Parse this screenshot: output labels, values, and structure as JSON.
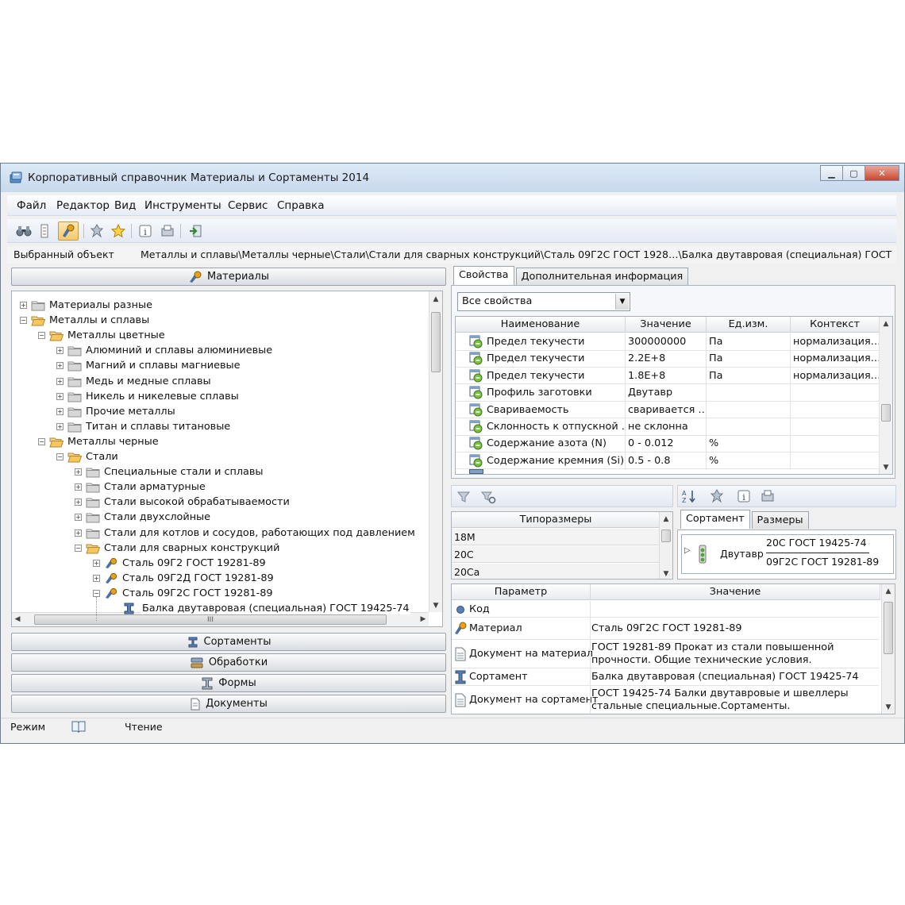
{
  "window": {
    "title": "Корпоративный справочник Материалы и Сортаменты 2014",
    "controls": {
      "minimize": "▁",
      "maximize": "▢",
      "close": "✕"
    }
  },
  "menu": [
    {
      "label": "Файл"
    },
    {
      "label": "Редактор"
    },
    {
      "label": "Вид"
    },
    {
      "label": "Инструменты"
    },
    {
      "label": "Сервис"
    },
    {
      "label": "Справка"
    }
  ],
  "toolbar": {
    "icons": [
      "binoculars-icon",
      "tree-icon",
      "materials-icon",
      "pin-icon",
      "star-icon",
      "info-icon",
      "report-icon",
      "exit-icon"
    ]
  },
  "selected_object": {
    "label": "Выбранный объект",
    "path": "Металлы и сплавы\\Металлы черные\\Стали\\Стали для сварных конструкций\\Сталь 09Г2С ГОСТ 1928…\\Балка двутавровая (специальная) ГОСТ 19425-74"
  },
  "left_panel": {
    "header": "Материалы",
    "tree": [
      {
        "label": "Материалы разные",
        "level": 0,
        "expanded": false,
        "icon": "folder"
      },
      {
        "label": "Металлы и сплавы",
        "level": 0,
        "expanded": true,
        "icon": "folder-open"
      },
      {
        "label": "Металлы цветные",
        "level": 1,
        "expanded": true,
        "icon": "folder-open"
      },
      {
        "label": "Алюминий и сплавы алюминиевые",
        "level": 2,
        "expanded": false,
        "icon": "folder"
      },
      {
        "label": "Магний и сплавы магниевые",
        "level": 2,
        "expanded": false,
        "icon": "folder"
      },
      {
        "label": "Медь и медные сплавы",
        "level": 2,
        "expanded": false,
        "icon": "folder"
      },
      {
        "label": "Никель и никелевые сплавы",
        "level": 2,
        "expanded": false,
        "icon": "folder"
      },
      {
        "label": "Прочие металлы",
        "level": 2,
        "expanded": false,
        "icon": "folder"
      },
      {
        "label": "Титан и сплавы титановые",
        "level": 2,
        "expanded": false,
        "icon": "folder"
      },
      {
        "label": "Металлы черные",
        "level": 1,
        "expanded": true,
        "icon": "folder-open"
      },
      {
        "label": "Стали",
        "level": 2,
        "expanded": true,
        "icon": "folder-open"
      },
      {
        "label": "Специальные стали и сплавы",
        "level": 3,
        "expanded": false,
        "icon": "folder"
      },
      {
        "label": "Стали  арматурные",
        "level": 3,
        "expanded": false,
        "icon": "folder"
      },
      {
        "label": "Стали высокой обрабатываемости",
        "level": 3,
        "expanded": false,
        "icon": "folder"
      },
      {
        "label": "Стали двухслойные",
        "level": 3,
        "expanded": false,
        "icon": "folder"
      },
      {
        "label": "Стали для котлов и сосудов, работающих под давлением",
        "level": 3,
        "expanded": false,
        "icon": "folder"
      },
      {
        "label": "Стали для сварных конструкций",
        "level": 3,
        "expanded": true,
        "icon": "folder-open"
      },
      {
        "label": "Сталь 09Г2 ГОСТ 19281-89",
        "level": 4,
        "expanded": false,
        "icon": "material"
      },
      {
        "label": "Сталь 09Г2Д ГОСТ 19281-89",
        "level": 4,
        "expanded": false,
        "icon": "material"
      },
      {
        "label": "Сталь 09Г2С ГОСТ 19281-89",
        "level": 4,
        "expanded": true,
        "icon": "material"
      },
      {
        "label": "Балка двутавровая (специальная) ГОСТ 19425-74",
        "level": 5,
        "expanded": null,
        "icon": "profile",
        "selected": true
      }
    ],
    "hscroll_mark": "III",
    "bottom_headers": [
      {
        "label": "Сортаменты",
        "icon": "profile-icon"
      },
      {
        "label": "Обработки",
        "icon": "processing-icon"
      },
      {
        "label": "Формы",
        "icon": "beam-icon"
      },
      {
        "label": "Документы",
        "icon": "document-icon"
      }
    ]
  },
  "properties": {
    "tabs": [
      "Свойства",
      "Дополнительная информация"
    ],
    "filter_value": "Все свойства",
    "columns": [
      "Наименование",
      "Значение",
      "Ед.изм.",
      "Контекст"
    ],
    "rows": [
      [
        "Предел текучести",
        "300000000",
        "Па",
        "нормализация…"
      ],
      [
        "Предел текучести",
        "2.2E+8",
        "Па",
        "нормализация…"
      ],
      [
        "Предел текучести",
        "1.8E+8",
        "Па",
        "нормализация…"
      ],
      [
        "Профиль заготовки",
        "Двутавр",
        "",
        ""
      ],
      [
        "Свариваемость",
        "сваривается …",
        "",
        ""
      ],
      [
        "Склонность к отпускной …",
        "не склонна",
        "",
        ""
      ],
      [
        "Содержание азота (N)",
        "0 - 0.012",
        "%",
        ""
      ],
      [
        "Содержание кремния (Si)",
        "0.5 - 0.8",
        "%",
        ""
      ]
    ]
  },
  "typesizes": {
    "column": "Типоразмеры",
    "rows": [
      "18M",
      "20C",
      "20Ca"
    ]
  },
  "sortament": {
    "tabs": [
      "Сортамент",
      "Размеры"
    ],
    "item_label": "Двутавр",
    "top_value": "20С ГОСТ 19425-74",
    "bottom_value": "09Г2С ГОСТ 19281-89"
  },
  "params": {
    "columns": [
      "Параметр",
      "Значение"
    ],
    "rows": [
      {
        "name": "Код",
        "value": "",
        "icon": "code-icon"
      },
      {
        "name": "Материал",
        "value": "Сталь 09Г2С ГОСТ 19281-89",
        "icon": "material-icon"
      },
      {
        "name": "Документ на материал",
        "value": "ГОСТ 19281-89 Прокат из стали повышенной прочности. Общие технические условия.",
        "icon": "document-icon"
      },
      {
        "name": "Сортамент",
        "value": "Балка двутавровая (специальная) ГОСТ 19425-74",
        "icon": "profile-icon"
      },
      {
        "name": "Документ на сортамент",
        "value": "ГОСТ 19425-74 Балки  двутавровые и швеллеры стальные специальные.Сортаменты.",
        "icon": "document-icon"
      }
    ]
  },
  "status": {
    "mode_label": "Режим",
    "mode_value": "Чтение"
  }
}
